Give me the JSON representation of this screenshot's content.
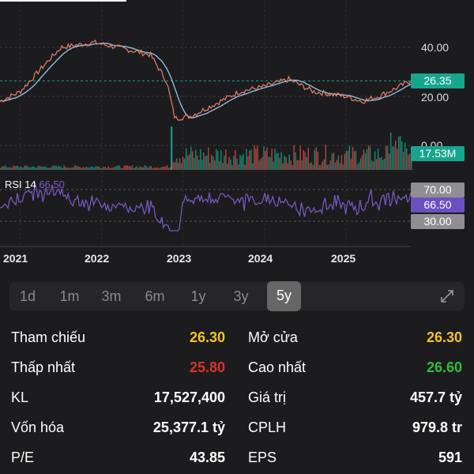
{
  "chart": {
    "price_axis": [
      "40.00",
      "20.00",
      "0.00"
    ],
    "last_price": "26.35",
    "volume_tag": "17.53M",
    "rsi_label": "RSI 14",
    "rsi_value": "66.50",
    "rsi_levels": [
      "70.00",
      "30.00"
    ],
    "years": [
      "2021",
      "2022",
      "2023",
      "2024",
      "2025"
    ],
    "colors": {
      "up": "#1aa58c",
      "down": "#e0504a",
      "ma": "#8fc8ee",
      "rsi": "#7a5cc8",
      "price_tag": "#17a58e"
    }
  },
  "chart_data": {
    "type": "line",
    "title": "5y price",
    "x": [
      2020.75,
      2021.0,
      2021.3,
      2021.5,
      2021.9,
      2022.2,
      2022.6,
      2022.8,
      2022.9,
      2023.1,
      2023.4,
      2023.7,
      2024.0,
      2024.3,
      2024.6,
      2024.8,
      2025.0,
      2025.2,
      2025.4,
      2025.6,
      2025.8
    ],
    "price": [
      18,
      22,
      33,
      40,
      42,
      40,
      37,
      26,
      11,
      12,
      17,
      22,
      24,
      27,
      22,
      21,
      20,
      18,
      20,
      23,
      26.35
    ],
    "ylim": [
      0,
      55
    ],
    "rsi_levels": [
      30,
      70
    ],
    "rsi_last": 66.5,
    "volume_last_m": 17.53
  },
  "timeframes": [
    "1d",
    "1m",
    "3m",
    "6m",
    "1y",
    "3y",
    "5y"
  ],
  "active_timeframe": "5y",
  "stats": [
    {
      "l": "Tham chiếu",
      "v": "26.30",
      "c": "#f2c12e",
      "l2": "Mở cửa",
      "v2": "26.30",
      "c2": "#f2c12e"
    },
    {
      "l": "Thấp nhất",
      "v": "25.80",
      "c": "#d9332b",
      "l2": "Cao nhất",
      "v2": "26.60",
      "c2": "#2fbf3a"
    },
    {
      "l": "KL",
      "v": "17,527,400",
      "c": "#fff",
      "l2": "Giá trị",
      "v2": "457.7 tỷ",
      "c2": "#fff"
    },
    {
      "l": "Vốn hóa",
      "v": "25,377.1 tỷ",
      "c": "#fff",
      "l2": "CPLH",
      "v2": "979.8 tr",
      "c2": "#fff"
    },
    {
      "l": "P/E",
      "v": "43.85",
      "c": "#fff",
      "l2": "EPS",
      "v2": "591",
      "c2": "#fff"
    }
  ]
}
